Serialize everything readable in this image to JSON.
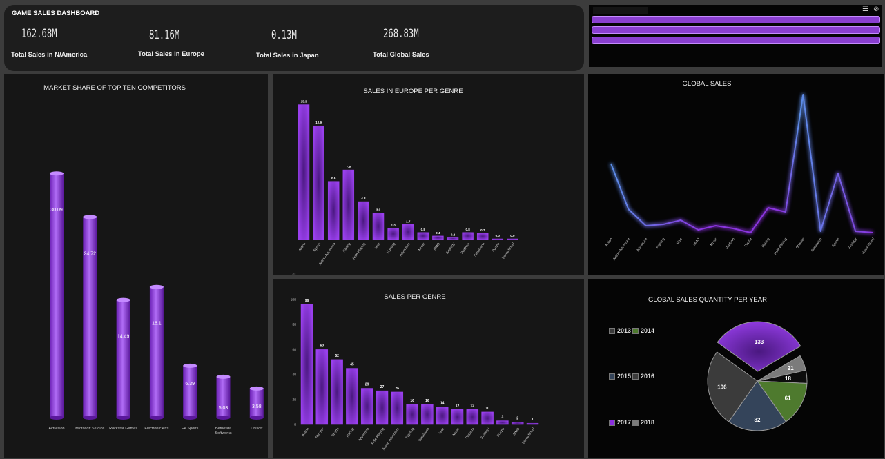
{
  "header": {
    "title": "GAME SALES DASHBOARD",
    "kpis": [
      {
        "value": "162.68M",
        "label": "Total Sales  in N/America"
      },
      {
        "value": "81.16M",
        "label": "Total Sales in Europe"
      },
      {
        "value": "0.13M",
        "label": "Total Sales in Japan"
      },
      {
        "value": "268.83M",
        "label": "Total Global Sales"
      }
    ]
  },
  "slicer": {
    "icons": [
      "multi-select-icon",
      "clear-filter-icon"
    ],
    "colors": {
      "button": "#8a3fd0"
    }
  },
  "chart_data": [
    {
      "id": "market_share",
      "type": "bar",
      "title": "MARKET SHARE OF TOP TEN COMPETITORS",
      "categories": [
        "Activision",
        "Microsoft Studios",
        "Rockstar Games",
        "Electronic Arts",
        "EA Sports",
        "Bethesda Softworks",
        "Ubisoft"
      ],
      "values": [
        30.09,
        24.72,
        14.49,
        16.1,
        6.39,
        5.03,
        3.58
      ],
      "ylim": [
        0,
        33
      ],
      "color": "#8b2fe0"
    },
    {
      "id": "europe_genre",
      "type": "bar",
      "title": "SALES  IN EUROPE PER GENRE",
      "categories": [
        "Action",
        "Sports",
        "Action-Adventure",
        "Racing",
        "Role-Playing",
        "Misc",
        "Fighting",
        "Adventure",
        "Music",
        "MMO",
        "Strategy",
        "Platform",
        "Simulation",
        "Puzzle",
        "Visual Novel"
      ],
      "values": [
        15.3,
        12.9,
        6.6,
        7.9,
        4.3,
        3.0,
        1.3,
        1.7,
        0.8,
        0.4,
        0.2,
        0.8,
        0.7,
        0.0,
        0.0
      ],
      "labels": [
        "15.3",
        "12.9",
        "6.6",
        "7.9",
        "4.3",
        "3.0",
        "1.3",
        "1.7",
        "0.8",
        "0.4",
        "0.2",
        "0.8",
        "0.7",
        "0.0",
        "0.0"
      ],
      "ylim": [
        0,
        15.5
      ],
      "color": "#8b2fe0"
    },
    {
      "id": "global_sales",
      "type": "line",
      "title": "GLOBAL SALES",
      "categories": [
        "Action",
        "Action-Adventure",
        "Adventure",
        "Fighting",
        "Misc",
        "MMO",
        "Music",
        "Platform",
        "Puzzle",
        "Racing",
        "Role-Playing",
        "Shooter",
        "Simulation",
        "Sports",
        "Strategy",
        "Visual Novel"
      ],
      "values": [
        50,
        17,
        5,
        6,
        9,
        2,
        5,
        3,
        0,
        18,
        15,
        100,
        1,
        43,
        1,
        0
      ],
      "color_start": "#5b8fe8",
      "color_end": "#8b35e0"
    },
    {
      "id": "sales_genre",
      "type": "bar",
      "title": "SALES PER GENRE",
      "categories": [
        "Action",
        "Shooter",
        "Sports",
        "Racing",
        "Adventure",
        "Role-Playing",
        "Action-Adventure",
        "Fighting",
        "Simulation",
        "Misc",
        "Music",
        "Platform",
        "Strategy",
        "Puzzle",
        "MMO",
        "Visual Novel"
      ],
      "values": [
        96,
        60,
        52,
        45,
        29,
        27,
        26,
        16,
        16,
        14,
        12,
        12,
        10,
        3,
        2,
        1
      ],
      "yticks": [
        0,
        20,
        40,
        60,
        80,
        100
      ],
      "top_tick": "120",
      "ylim": [
        0,
        100
      ],
      "color": "#8b2fe0"
    },
    {
      "id": "sales_per_year",
      "type": "pie",
      "title": "GLOBAL SALES QUANTITY PER YEAR",
      "categories": [
        "2013",
        "2014",
        "2015",
        "2016",
        "2017",
        "2018"
      ],
      "values": [
        18,
        61,
        82,
        106,
        133,
        21
      ],
      "colors": [
        "#0d0d0d",
        "#4e7a2e",
        "#34445a",
        "#3b3b3b",
        "#8b2fe0",
        "#7b7b7b"
      ],
      "legend": [
        {
          "label": "2013",
          "color": "#3a3a3a"
        },
        {
          "label": "2014",
          "color": "#4e7a2e"
        },
        {
          "label": "2015",
          "color": "#34445a"
        },
        {
          "label": "2016",
          "color": "#3b3b3b"
        },
        {
          "label": "2017",
          "color": "#8b2fe0"
        },
        {
          "label": "2018",
          "color": "#7b7b7b"
        }
      ]
    }
  ]
}
